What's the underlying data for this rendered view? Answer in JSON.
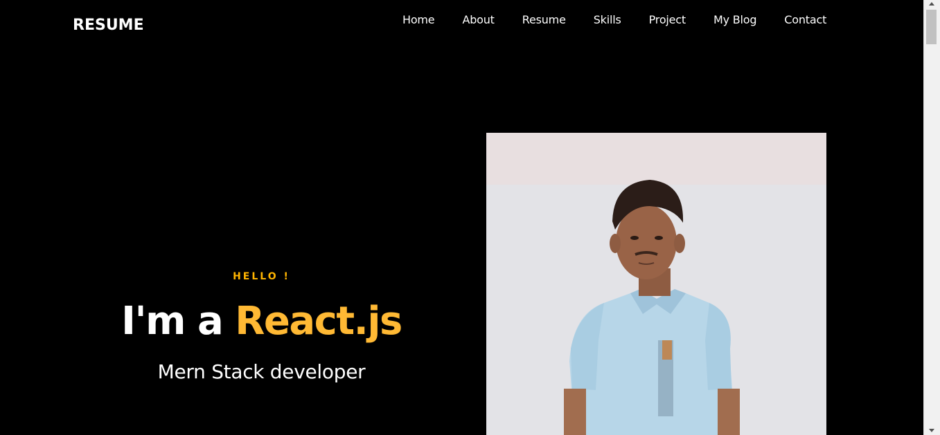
{
  "brand": {
    "logo": "RESUME"
  },
  "nav": {
    "items": [
      {
        "label": "Home"
      },
      {
        "label": "About"
      },
      {
        "label": "Resume"
      },
      {
        "label": "Skills"
      },
      {
        "label": "Project"
      },
      {
        "label": "My Blog"
      },
      {
        "label": "Contact"
      }
    ]
  },
  "hero": {
    "greeting": "HELLO !",
    "headline_prefix": "I'm a ",
    "headline_accent": "React.js",
    "subtitle": "Mern Stack developer"
  },
  "colors": {
    "background": "#000000",
    "accent": "#ffb934",
    "text": "#ffffff"
  }
}
